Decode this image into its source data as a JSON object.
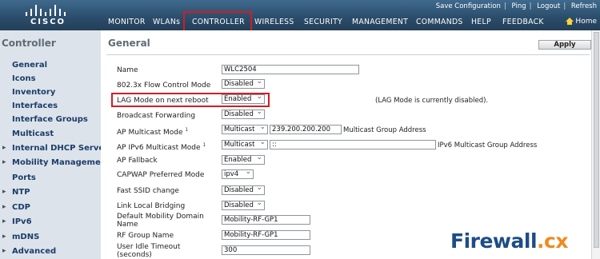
{
  "header": {
    "logo_text": "CISCO",
    "top_links": [
      "Save Configuration",
      "Ping",
      "Logout",
      "Refresh"
    ],
    "nav": [
      "MONITOR",
      "WLANs",
      "CONTROLLER",
      "WIRELESS",
      "SECURITY",
      "MANAGEMENT",
      "COMMANDS",
      "HELP",
      "FEEDBACK"
    ],
    "home_label": "Home",
    "active_nav": "CONTROLLER"
  },
  "sidebar": {
    "title": "Controller",
    "items": [
      "General",
      "Icons",
      "Inventory",
      "Interfaces",
      "Interface Groups",
      "Multicast",
      "Internal DHCP Server",
      "Mobility Management",
      "Ports",
      "NTP",
      "CDP",
      "IPv6",
      "mDNS",
      "Advanced"
    ]
  },
  "main": {
    "title": "General",
    "apply_label": "Apply",
    "rows": {
      "name": {
        "label": "Name",
        "value": "WLC2504"
      },
      "flow_control": {
        "label": "802.3x Flow Control Mode",
        "value": "Disabled"
      },
      "lag_mode": {
        "label": "LAG Mode on next reboot",
        "value": "Enabled",
        "note": "(LAG Mode is currently disabled)."
      },
      "broadcast_forwarding": {
        "label": "Broadcast Forwarding",
        "value": "Disabled"
      },
      "ap_multicast": {
        "label": "AP Multicast Mode",
        "mode": "Multicast",
        "address": "239.200.200.200",
        "note": "Multicast Group Address",
        "sup": "1"
      },
      "ap_ipv6_multicast": {
        "label": "AP IPv6 Multicast Mode",
        "mode": "Multicast",
        "address": "::",
        "note": "IPv6 Multicast Group Address",
        "sup": "1"
      },
      "ap_fallback": {
        "label": "AP Fallback",
        "value": "Enabled"
      },
      "capwap_mode": {
        "label": "CAPWAP Preferred Mode",
        "value": "ipv4"
      },
      "fast_ssid": {
        "label": "Fast SSID change",
        "value": "Disabled"
      },
      "link_local": {
        "label": "Link Local Bridging",
        "value": "Disabled"
      },
      "mobility_domain": {
        "label_line1": "Default Mobility Domain",
        "label_line2": "Name",
        "value": "Mobility-RF-GP1"
      },
      "rf_group": {
        "label": "RF Group Name",
        "value": "Mobility-RF-GP1"
      },
      "idle_timeout": {
        "label_line1": "User Idle Timeout",
        "label_line2": "(seconds)",
        "value": "300"
      }
    }
  },
  "watermark": {
    "main": "Firewall",
    "suffix": ".cx"
  },
  "colors": {
    "header": "#2f5677",
    "sidebar": "#dde3ea",
    "highlight": "#d41c24",
    "nav_text": "#ffffff"
  }
}
